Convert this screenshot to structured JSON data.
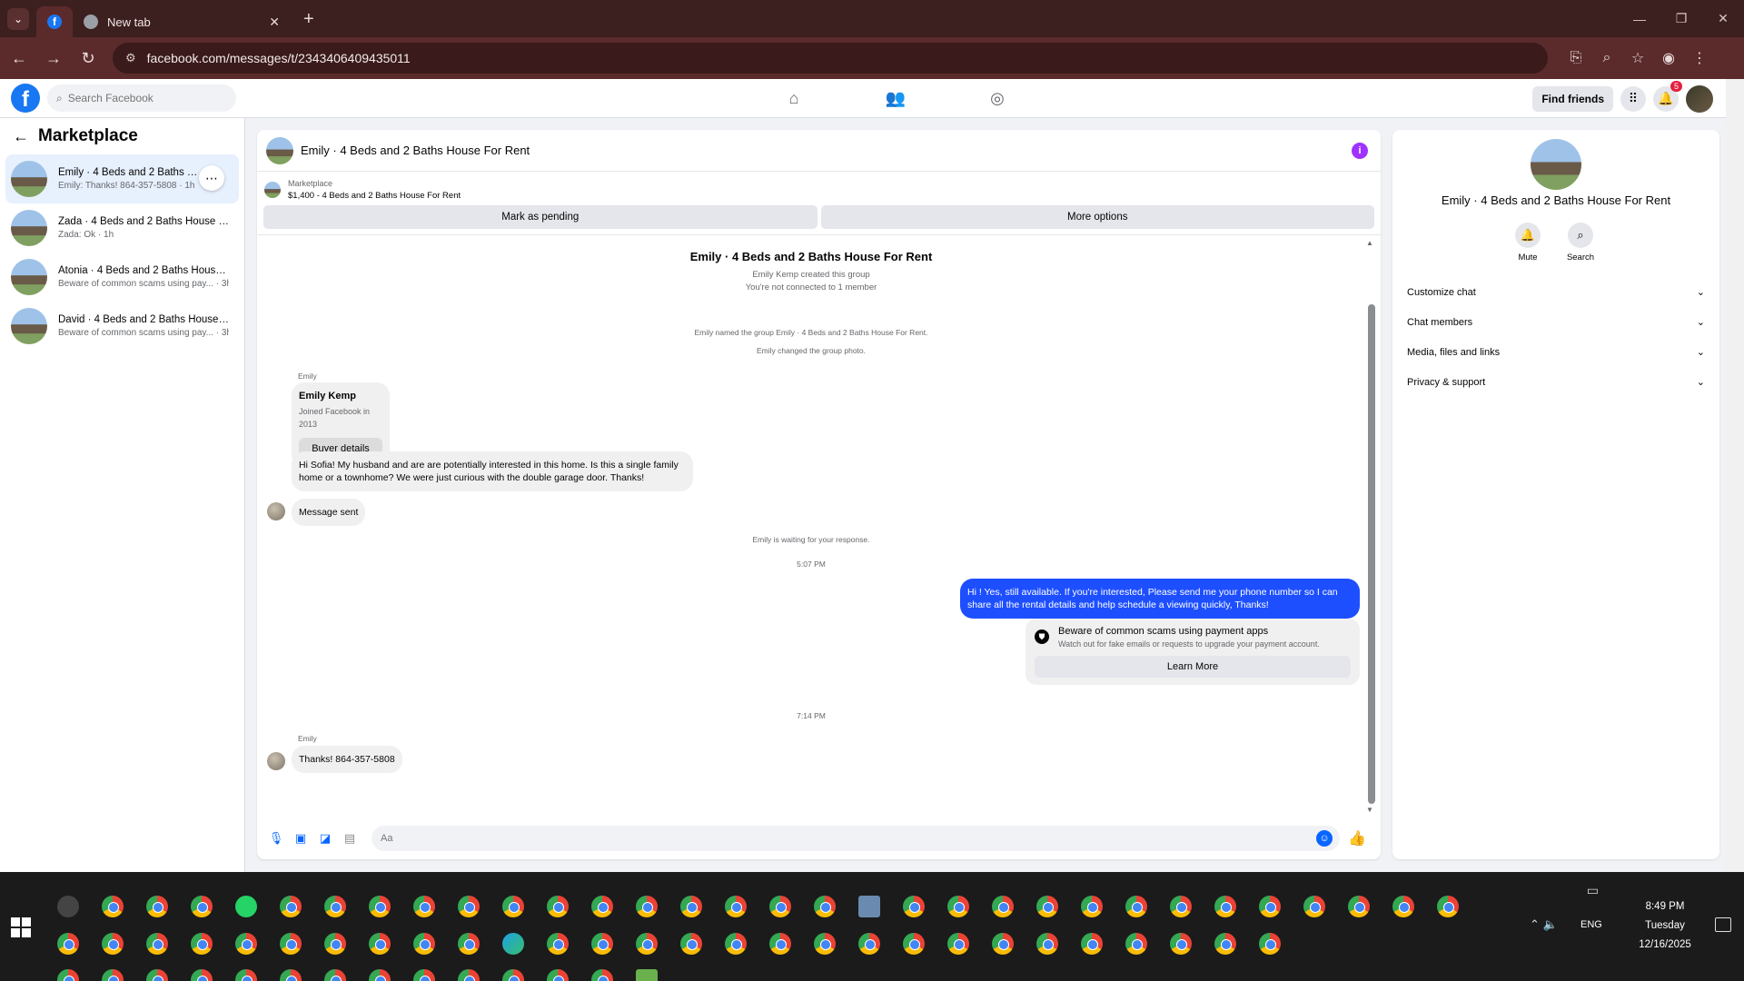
{
  "browser": {
    "tabs": [
      {
        "title": "",
        "favicon": "facebook-icon",
        "active": true
      },
      {
        "title": "New tab",
        "favicon": "chrome-icon",
        "active": false
      }
    ],
    "url": "facebook.com/messages/t/2343406409435011"
  },
  "fb": {
    "search_placeholder": "Search Facebook",
    "find_friends": "Find friends",
    "notif_count": "5"
  },
  "sidebar": {
    "title": "Marketplace",
    "conversations": [
      {
        "name": "Emily · 4 Beds and 2 Baths House For Rent",
        "sub": "Emily: Thanks! 864-357-5808 · 1h"
      },
      {
        "name": "Zada · 4 Beds and 2 Baths House For Rent",
        "sub": "Zada: Ok · 1h"
      },
      {
        "name": "Atonia · 4 Beds and 2 Baths House For Rent",
        "sub": "Beware of common scams using pay... · 3h"
      },
      {
        "name": "David · 4 Beds and 2 Baths House For Rent",
        "sub": "Beware of common scams using pay... · 3h"
      }
    ]
  },
  "chat": {
    "title": "Emily · 4 Beds and 2 Baths House For Rent",
    "marketplace_label": "Marketplace",
    "listing": "$1,400 - 4 Beds and 2 Baths House For Rent",
    "mark_pending": "Mark as pending",
    "more_options": "More options",
    "group_title": "Emily · 4 Beds and 2 Baths House For Rent",
    "created": "Emily Kemp created this group",
    "not_connected": "You're not connected to 1 member",
    "named_group": "Emily named the group Emily · 4 Beds and 2 Baths House For Rent.",
    "changed_photo": "Emily changed the group photo.",
    "sender1": "Emily",
    "buyer_name": "Emily Kemp",
    "buyer_joined": "Joined Facebook in 2013",
    "buyer_details": "Buyer details",
    "msg1": "Hi Sofia! My husband and are are potentially interested in this home. Is this a single family home or a townhome? We were just curious with the double garage door. Thanks!",
    "msg_sent": "Message sent",
    "waiting": "Emily is waiting for your response.",
    "time1": "5:07 PM",
    "my_msg": "Hi ! Yes, still available. If you're interested, Please send me your phone number so I can share all the rental details and help schedule a viewing quickly, Thanks!",
    "scam_title": "Beware of common scams using payment apps",
    "scam_sub": "Watch out for fake emails or requests to upgrade your payment account.",
    "learn_more": "Learn More",
    "time2": "7:14 PM",
    "sender2": "Emily",
    "msg2": "Thanks! 864-357-5808",
    "composer_placeholder": "Aa"
  },
  "rpanel": {
    "name": "Emily · 4 Beds and 2 Baths House For Rent",
    "mute": "Mute",
    "search": "Search",
    "items": [
      "Customize chat",
      "Chat members",
      "Media, files and links",
      "Privacy & support"
    ]
  },
  "taskbar": {
    "time": "8:49 PM",
    "day": "Tuesday",
    "date": "12/16/2025",
    "lang": "ENG"
  },
  "colors": {
    "fb_blue": "#1877f2",
    "my_bubble": "#1d4fff",
    "accent_purple": "#a033ff"
  }
}
